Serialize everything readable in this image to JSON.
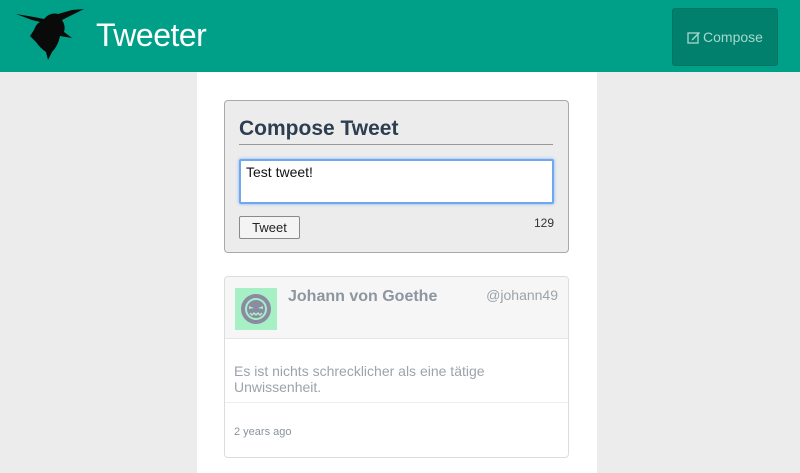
{
  "navbar": {
    "brand": "Tweeter",
    "compose_label": "Compose",
    "compose_icon": "edit-icon",
    "logo_icon": "hummingbird-logo",
    "background": "#009f87",
    "button_color": "#00806d"
  },
  "compose": {
    "title": "Compose Tweet",
    "input_value": "Test tweet!",
    "tweet_button": "Tweet",
    "char_count": "129"
  },
  "tweets": [
    {
      "author": "Johann von Goethe",
      "handle": "@johann49",
      "text": "Es ist nichts schrecklicher als eine tätige Unwissenheit.",
      "timestamp": "2 years ago",
      "avatar_icon": "robot-face-avatar",
      "avatar_color": "#a7f0c6"
    }
  ]
}
